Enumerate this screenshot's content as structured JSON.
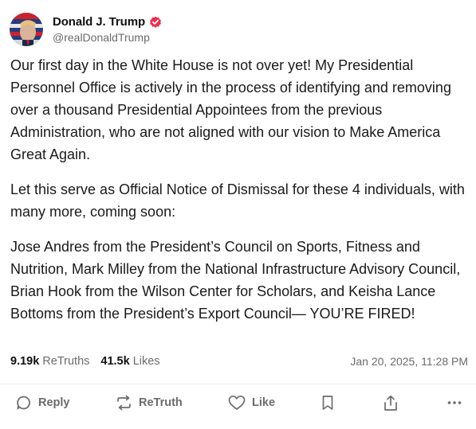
{
  "author": {
    "display_name": "Donald J. Trump",
    "handle": "@realDonaldTrump",
    "verified_badge_icon": "verified-check-icon"
  },
  "post": {
    "paragraphs": [
      "Our first day in the White House is not over yet! My Presidential Personnel Office is actively in the process of identifying and removing over a thousand Presidential Appointees from the previous Administration, who are not aligned with our vision to Make America Great Again.",
      "Let this serve as Official Notice of Dismissal for these 4 individuals, with many more, coming soon:",
      "Jose Andres from the President’s Council on Sports, Fitness and Nutrition, Mark Milley from the National Infrastructure Advisory Council, Brian Hook from the Wilson Center for Scholars, and Keisha Lance Bottoms from the President’s Export Council— YOU’RE FIRED!"
    ]
  },
  "stats": {
    "retruths_count": "9.19k",
    "retruths_label": "ReTruths",
    "likes_count": "41.5k",
    "likes_label": "Likes",
    "timestamp": "Jan 20, 2025, 11:28 PM"
  },
  "actions": {
    "reply": {
      "label": "Reply",
      "icon": "reply-icon"
    },
    "retruth": {
      "label": "ReTruth",
      "icon": "retruth-icon"
    },
    "like": {
      "label": "Like",
      "icon": "heart-icon"
    },
    "bookmark": {
      "icon": "bookmark-icon"
    },
    "share": {
      "icon": "share-icon"
    },
    "more": {
      "icon": "more-icon"
    }
  },
  "colors": {
    "verified_badge": "#e8304f",
    "text_primary": "#1a1a1a",
    "text_secondary": "#6b6b6b"
  }
}
